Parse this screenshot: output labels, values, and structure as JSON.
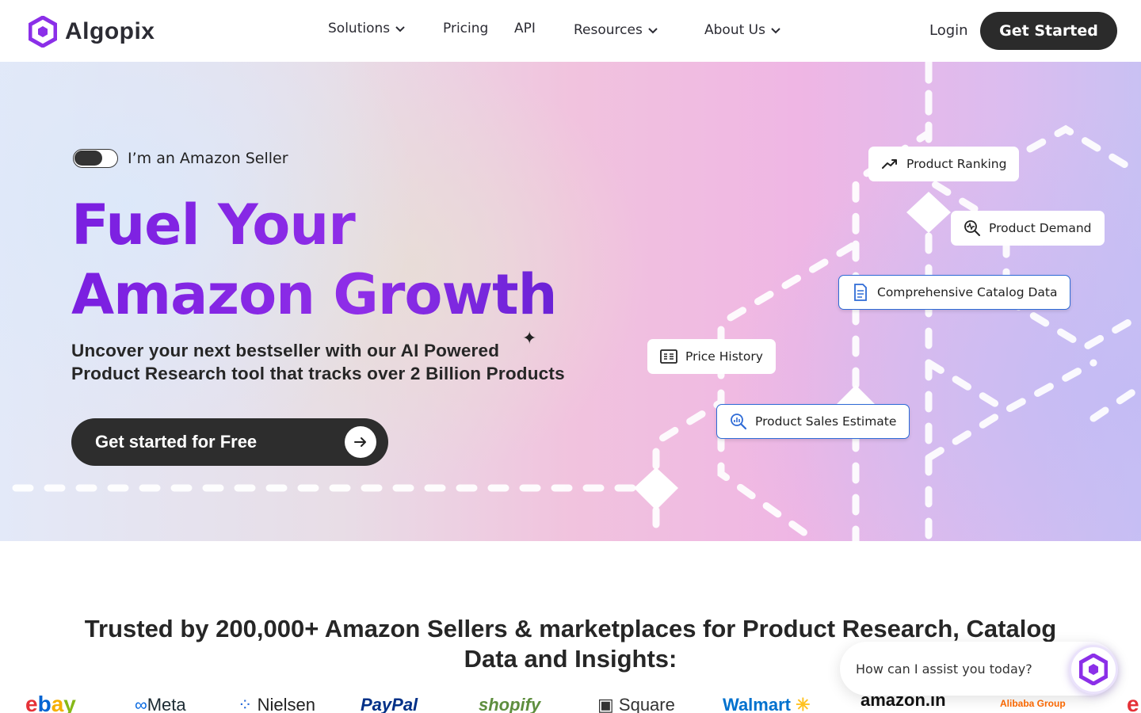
{
  "brand": {
    "name": "Algopix",
    "accent": "#8b2fe8",
    "dark": "#2b2b2b",
    "logo_icon": "hexagon-logo-icon"
  },
  "nav": {
    "items": [
      {
        "label": "Solutions",
        "has_dropdown": true
      },
      {
        "label": "Pricing",
        "has_dropdown": false
      },
      {
        "label": "API",
        "has_dropdown": false
      },
      {
        "label": "Resources",
        "has_dropdown": true
      },
      {
        "label": "About Us",
        "has_dropdown": true
      }
    ],
    "login": "Login",
    "get_started": "Get Started"
  },
  "hero": {
    "toggle_label": "I’m an Amazon Seller",
    "toggle_on": false,
    "headline_line1": "Fuel Your",
    "headline_line2": "Amazon Growth",
    "sub_line1": "Uncover your next bestseller with our AI Powered",
    "sub_line2": "Product Research tool that tracks over 2 Billion Products",
    "sparkle": "✦",
    "cta": "Get started for Free",
    "cta_icon": "arrow-right-icon",
    "features": [
      {
        "label": "Product Ranking",
        "icon": "trending-up-icon"
      },
      {
        "label": "Product Demand",
        "icon": "demand-search-icon"
      },
      {
        "label": "Comprehensive Catalog Data",
        "icon": "document-icon"
      },
      {
        "label": "Price History",
        "icon": "price-tag-icon"
      },
      {
        "label": "Product Sales Estimate",
        "icon": "analytics-search-icon"
      }
    ]
  },
  "trusted": {
    "title_line1": "Trusted by 200,000+ Amazon Sellers & marketplaces for Product Research, Catalog",
    "title_line2": "Data and Insights:",
    "logos": [
      "ebay",
      "Meta",
      "Nielsen",
      "PayPal",
      "shopify",
      "Square",
      "Walmart",
      "amazon.in",
      "Alibaba Group",
      "e"
    ]
  },
  "chat": {
    "prompt": "How can I assist you today?"
  }
}
